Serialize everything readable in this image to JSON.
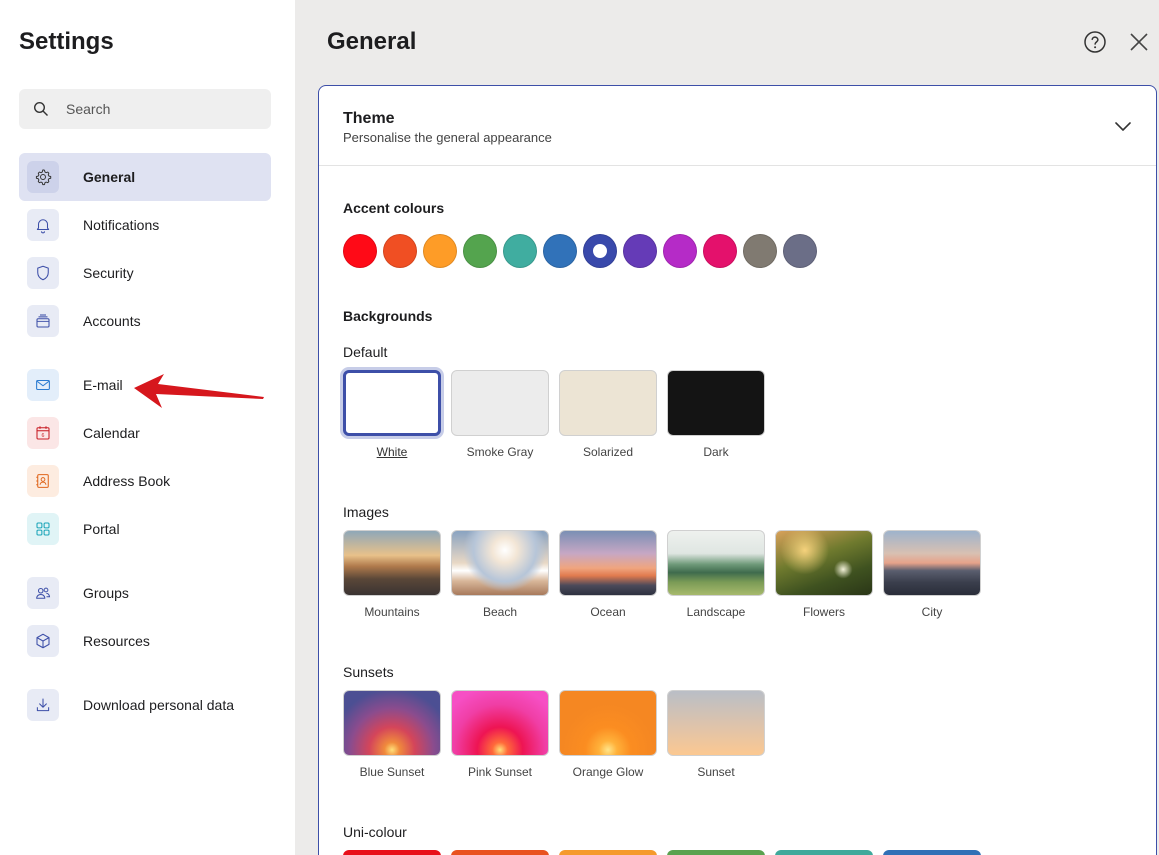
{
  "sidebar": {
    "title": "Settings",
    "search_placeholder": "Search",
    "items": [
      {
        "label": "General"
      },
      {
        "label": "Notifications"
      },
      {
        "label": "Security"
      },
      {
        "label": "Accounts"
      },
      {
        "label": "E-mail"
      },
      {
        "label": "Calendar"
      },
      {
        "label": "Address Book"
      },
      {
        "label": "Portal"
      },
      {
        "label": "Groups"
      },
      {
        "label": "Resources"
      },
      {
        "label": "Download personal data"
      }
    ],
    "calendar_icon_day": "6"
  },
  "main": {
    "title": "General",
    "theme": {
      "title": "Theme",
      "subtitle": "Personalise the general appearance"
    },
    "accent": {
      "label": "Accent colours",
      "colors": [
        "#ff0a17",
        "#f04f23",
        "#fe9c27",
        "#54a44e",
        "#40ada0",
        "#3172b9",
        "#3949ab",
        "#653bb7",
        "#b52bc7",
        "#e4116c",
        "#807a71",
        "#6b6e87"
      ],
      "selected_color": "#3949ab"
    },
    "backgrounds": {
      "label": "Backgrounds",
      "default_label": "Default",
      "default": [
        {
          "name": "White",
          "color": "#ffffff"
        },
        {
          "name": "Smoke Gray",
          "color": "#ececec"
        },
        {
          "name": "Solarized",
          "color": "#ece4d4"
        },
        {
          "name": "Dark",
          "color": "#141414"
        }
      ],
      "selected": "White",
      "images_label": "Images",
      "images": [
        {
          "name": "Mountains"
        },
        {
          "name": "Beach"
        },
        {
          "name": "Ocean"
        },
        {
          "name": "Landscape"
        },
        {
          "name": "Flowers"
        },
        {
          "name": "City"
        }
      ],
      "sunsets_label": "Sunsets",
      "sunsets": [
        {
          "name": "Blue Sunset"
        },
        {
          "name": "Pink Sunset"
        },
        {
          "name": "Orange Glow"
        },
        {
          "name": "Sunset"
        }
      ],
      "unicolour_label": "Uni-colour",
      "unicolour": [
        "#e8101a",
        "#e9521f",
        "#f59a2c",
        "#5aa24f",
        "#3fa99b",
        "#3070b6"
      ]
    }
  },
  "colors": {
    "accent": "#3d4fa8",
    "active_bg": "#dfe2f2",
    "annotation_arrow": "#d6171d"
  }
}
